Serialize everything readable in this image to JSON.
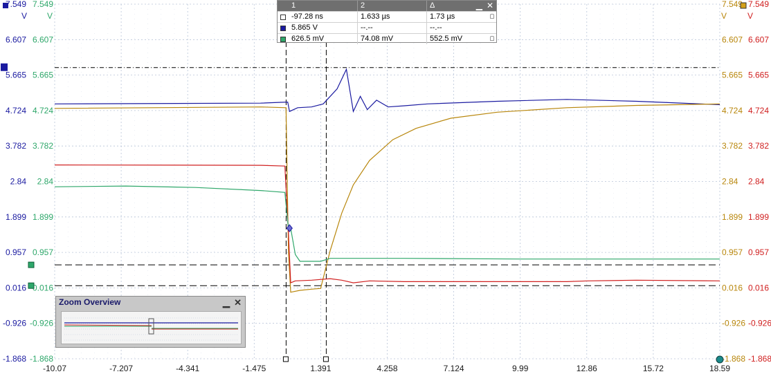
{
  "chart_data": {
    "type": "line",
    "x_ticks": [
      "-10.07",
      "-7.207",
      "-4.341",
      "-1.475",
      "1.391",
      "4.258",
      "7.124",
      "9.99",
      "12.86",
      "15.72",
      "18.59"
    ],
    "xlim": [
      -10.07,
      18.59
    ],
    "ylim": [
      -1.868,
      7.549
    ],
    "left_axis_1": {
      "unit": "V",
      "color": "#1a1aa0",
      "ticks": [
        "7.549",
        "6.607",
        "5.665",
        "4.724",
        "3.782",
        "2.84",
        "1.899",
        "0.957",
        "0.016",
        "-0.926",
        "-1.868"
      ]
    },
    "left_axis_2": {
      "unit": "V",
      "color": "#2ea76a",
      "ticks": [
        "7.549",
        "6.607",
        "5.665",
        "4.724",
        "3.782",
        "2.84",
        "1.899",
        "0.957",
        "0.016",
        "-0.926",
        "-1.868"
      ]
    },
    "right_axis_1": {
      "unit": "V",
      "color": "#b8860b",
      "ticks": [
        "7.549",
        "6.607",
        "5.665",
        "4.724",
        "3.782",
        "2.84",
        "1.899",
        "0.957",
        "0.016",
        "-0.926",
        "-1.868"
      ]
    },
    "right_axis_2": {
      "unit": "V",
      "color": "#d02020",
      "ticks": [
        "7.549",
        "6.607",
        "5.665",
        "4.724",
        "3.782",
        "2.84",
        "1.899",
        "0.957",
        "0.016",
        "-0.926",
        "-1.868"
      ]
    },
    "series": [
      {
        "color": "#1a1aa0",
        "x": [
          -10.07,
          -1.2,
          -0.03,
          0.05,
          0.4,
          1.0,
          1.5,
          2.1,
          2.5,
          2.8,
          3.1,
          3.4,
          3.8,
          4.3,
          5.0,
          6.0,
          9.0,
          12.0,
          15.0,
          18.59
        ],
        "y": [
          4.9,
          4.92,
          4.95,
          4.7,
          4.8,
          4.82,
          4.9,
          5.3,
          5.82,
          4.7,
          5.1,
          4.75,
          5.0,
          4.82,
          4.85,
          4.9,
          4.97,
          5.02,
          4.97,
          4.88
        ]
      },
      {
        "color": "#b8860b",
        "x": [
          -10.07,
          -1.2,
          -0.1,
          0.0,
          0.1,
          0.5,
          1.0,
          1.391,
          1.8,
          2.3,
          2.8,
          3.5,
          4.5,
          5.5,
          7.0,
          9.0,
          12.0,
          15.0,
          18.59
        ],
        "y": [
          4.78,
          4.82,
          4.8,
          1.0,
          -0.1,
          -0.05,
          -0.02,
          0.0,
          1.0,
          2.0,
          2.75,
          3.4,
          3.95,
          4.25,
          4.52,
          4.68,
          4.8,
          4.86,
          4.9
        ]
      },
      {
        "color": "#d02020",
        "x": [
          -10.07,
          -1.2,
          -0.15,
          0.0,
          0.1,
          0.3,
          1.0,
          1.8,
          2.3,
          2.8,
          3.5,
          5.0,
          8.0,
          12.0,
          12.9,
          15.0,
          18.59
        ],
        "y": [
          3.28,
          3.27,
          3.25,
          1.5,
          0.15,
          0.2,
          0.22,
          0.26,
          0.22,
          0.15,
          0.2,
          0.18,
          0.18,
          0.18,
          0.2,
          0.22,
          0.2
        ]
      },
      {
        "color": "#2ea76a",
        "x": [
          -10.07,
          -7.0,
          -4.0,
          -1.2,
          -0.15,
          0.0,
          0.1,
          0.3,
          0.5,
          1.391,
          1.8,
          2.5,
          5.0,
          10.0,
          15.0,
          18.59
        ],
        "y": [
          2.7,
          2.72,
          2.68,
          2.6,
          2.55,
          1.6,
          1.6,
          0.9,
          0.72,
          0.72,
          0.8,
          0.8,
          0.8,
          0.78,
          0.78,
          0.78
        ]
      }
    ],
    "cursors": {
      "vertical_x": [
        -0.097,
        1.633
      ],
      "horizontal_dash_y": [
        5.865,
        0.6265,
        0.074
      ],
      "marker_y_diamond": 1.6
    },
    "grid": true
  },
  "rulers": {
    "headers": [
      "1",
      "2",
      "Δ"
    ],
    "rows": [
      {
        "swatch": "#ffffff",
        "v1": "-97.28 ns",
        "v2": "1.633 µs",
        "d": "1.73 µs"
      },
      {
        "swatch": "#1a1aa0",
        "v1": "5.865 V",
        "v2": "--.--",
        "d": "--.--"
      },
      {
        "swatch": "#2ea76a",
        "v1": "626.5 mV",
        "v2": "74.08 mV",
        "d": "552.5 mV"
      }
    ],
    "minimize_glyph": "▁",
    "close_glyph": "✕"
  },
  "zoom_overview": {
    "title": "Zoom Overview",
    "minimize_glyph": "▁",
    "close_glyph": "✕"
  }
}
